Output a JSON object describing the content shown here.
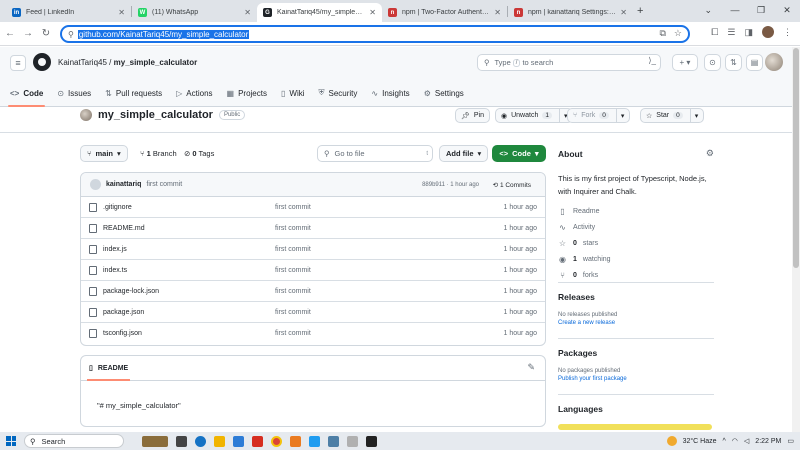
{
  "browser": {
    "tabs": [
      {
        "title": "Feed | LinkedIn",
        "color": "#0a66c2",
        "glyph": "in"
      },
      {
        "title": "(11) WhatsApp",
        "color": "#25d366",
        "glyph": "W"
      },
      {
        "title": "KainatTariq45/my_simple_calcu",
        "color": "#1f2328",
        "glyph": "G"
      },
      {
        "title": "npm | Two-Factor Authenticatio",
        "color": "#cb3837",
        "glyph": "n"
      },
      {
        "title": "npm | kainattariq Settings: Pac",
        "color": "#cb3837",
        "glyph": "n"
      }
    ],
    "url": "github.com/KainatTariq45/my_simple_calculator"
  },
  "header": {
    "owner": "KainatTariq45",
    "separator": "/",
    "repo": "my_simple_calculator",
    "search_prefix": "Type",
    "search_key": "/",
    "search_suffix": "to search",
    "plus": "+ ▾"
  },
  "nav": [
    {
      "label": "Code",
      "icon": "<>",
      "name": "code"
    },
    {
      "label": "Issues",
      "icon": "⊙",
      "name": "issues"
    },
    {
      "label": "Pull requests",
      "icon": "⇅",
      "name": "pull-requests"
    },
    {
      "label": "Actions",
      "icon": "▷",
      "name": "actions"
    },
    {
      "label": "Projects",
      "icon": "▦",
      "name": "projects"
    },
    {
      "label": "Wiki",
      "icon": "▯",
      "name": "wiki"
    },
    {
      "label": "Security",
      "icon": "⛨",
      "name": "security"
    },
    {
      "label": "Insights",
      "icon": "∿",
      "name": "insights"
    },
    {
      "label": "Settings",
      "icon": "⚙",
      "name": "settings"
    }
  ],
  "repo": {
    "name": "my_simple_calculator",
    "visibility": "Public",
    "pin": "Pin",
    "unwatch": "Unwatch",
    "watch_count": "1",
    "fork": "Fork",
    "fork_count": "0",
    "star": "Star",
    "star_count": "0"
  },
  "toolbar": {
    "branch": "main",
    "branch_count": "1",
    "branch_label": "Branch",
    "tag_count": "0",
    "tag_label": "Tags",
    "goto_placeholder": "Go to file",
    "goto_key": "t",
    "add_file": "Add file",
    "code": "Code"
  },
  "commit": {
    "user": "kainattariq",
    "message": "first commit",
    "hash_time": "889b911 · 1 hour ago",
    "commits": "1 Commits"
  },
  "files": [
    {
      "name": ".gitignore",
      "message": "first commit",
      "age": "1 hour ago"
    },
    {
      "name": "README.md",
      "message": "first commit",
      "age": "1 hour ago"
    },
    {
      "name": "index.js",
      "message": "first commit",
      "age": "1 hour ago"
    },
    {
      "name": "index.ts",
      "message": "first commit",
      "age": "1 hour ago"
    },
    {
      "name": "package-lock.json",
      "message": "first commit",
      "age": "1 hour ago"
    },
    {
      "name": "package.json",
      "message": "first commit",
      "age": "1 hour ago"
    },
    {
      "name": "tsconfig.json",
      "message": "first commit",
      "age": "1 hour ago"
    }
  ],
  "readme": {
    "tab": "README",
    "content": "\"# my_simple_calculator\""
  },
  "about": {
    "title": "About",
    "description": "This is my first project of Typescript, Node.js, with Inquirer and Chalk.",
    "readme": "Readme",
    "activity": "Activity",
    "stars_count": "0",
    "stars_label": "stars",
    "watching_count": "1",
    "watching_label": "watching",
    "forks_count": "0",
    "forks_label": "forks"
  },
  "releases": {
    "title": "Releases",
    "empty": "No releases published",
    "link": "Create a new release"
  },
  "packages": {
    "title": "Packages",
    "empty": "No packages published",
    "link": "Publish your first package"
  },
  "languages": {
    "title": "Languages"
  },
  "taskbar": {
    "search": "Search",
    "weather": "32°C Haze",
    "time": "2:22 PM"
  },
  "colors": {
    "accent": "#1f883d",
    "link": "#0969da",
    "tab_underline": "#fd8c73",
    "language_bar": "#f1e05a"
  }
}
